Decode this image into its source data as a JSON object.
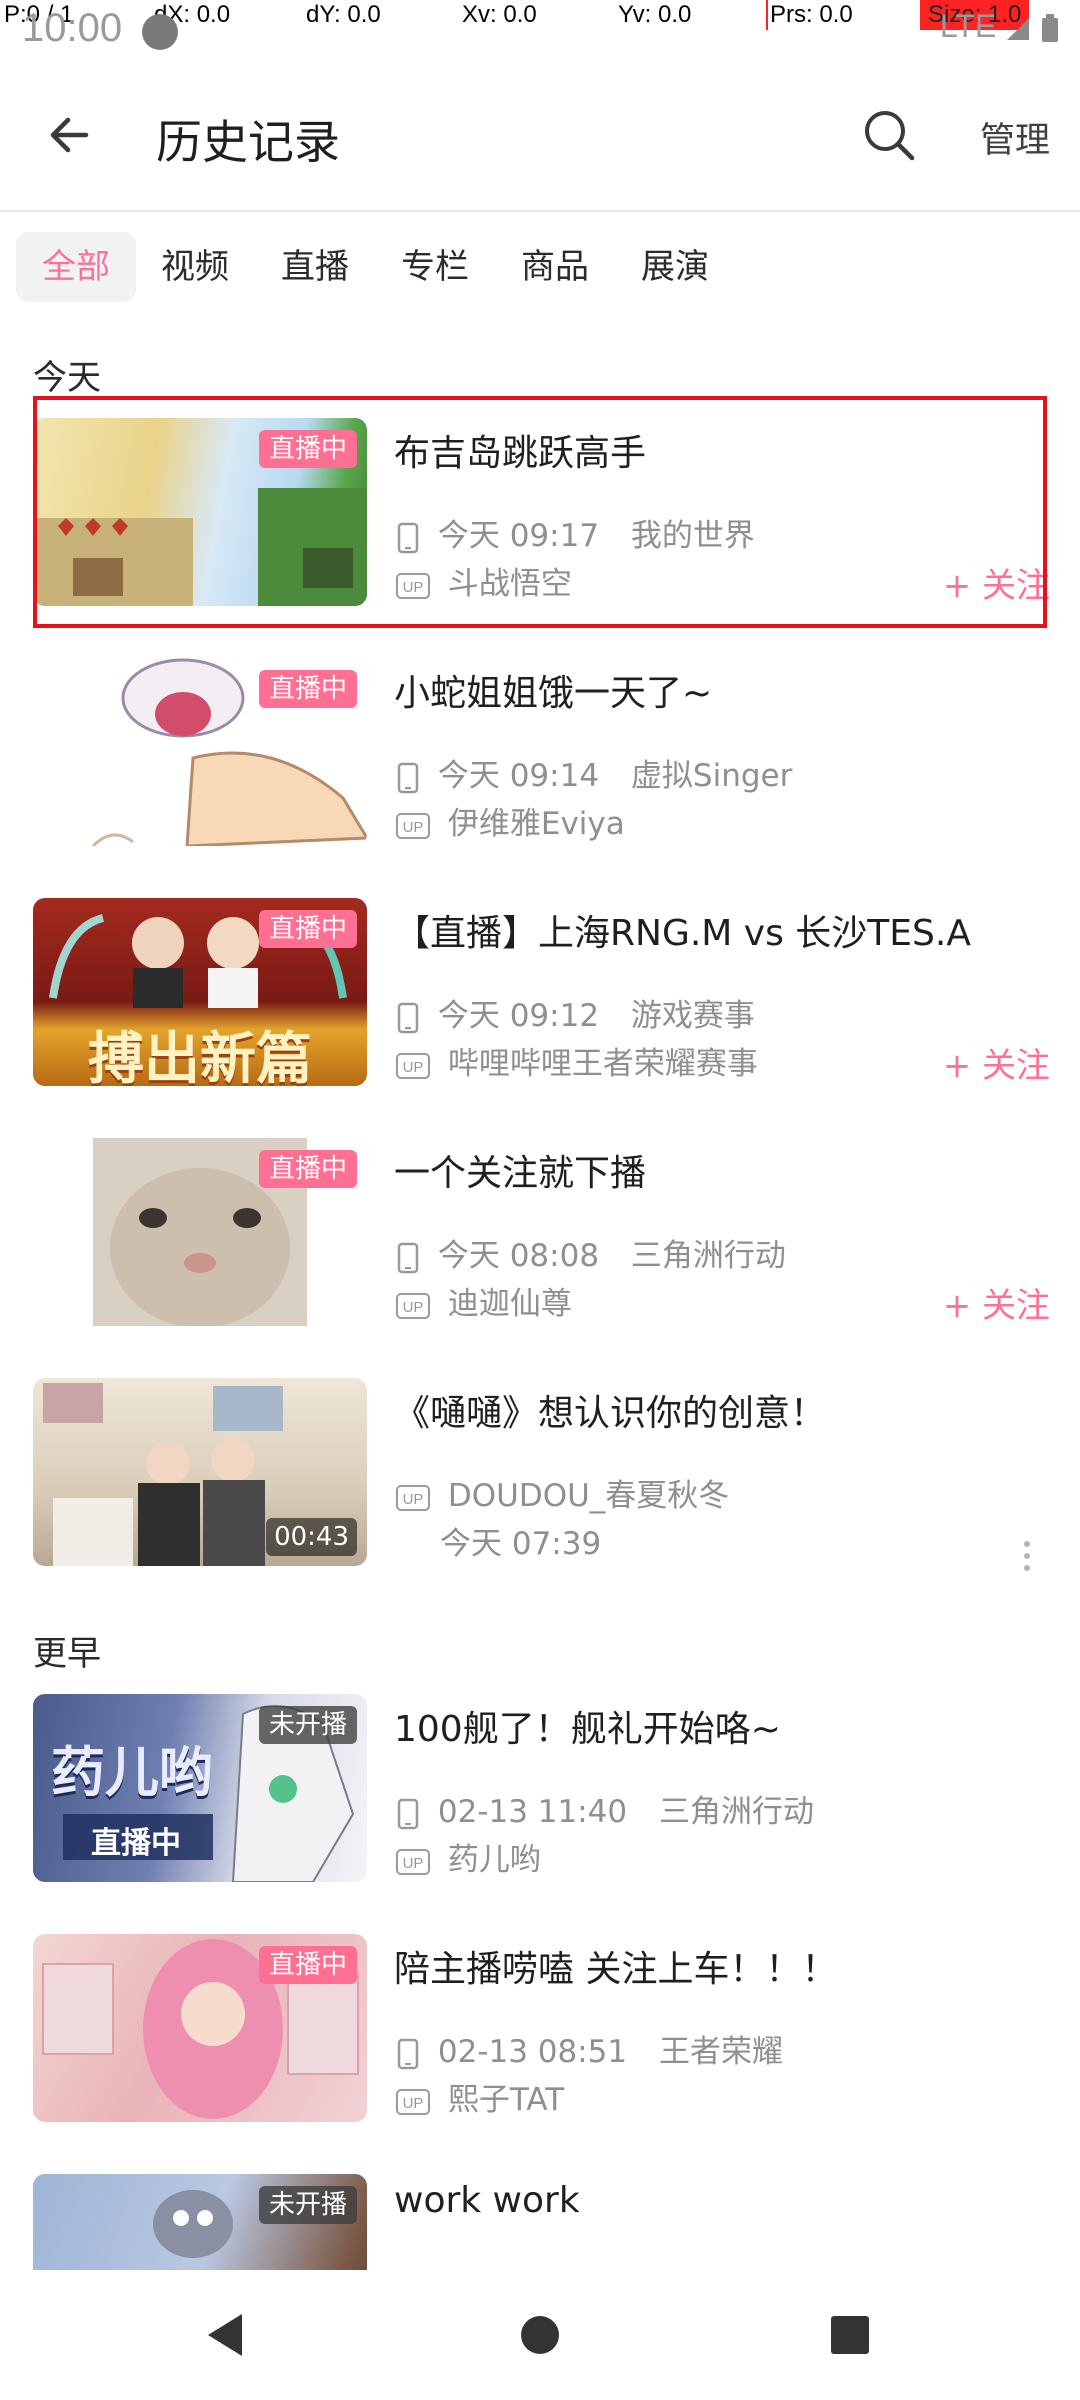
{
  "debug": {
    "pointer": "P:0 / 1",
    "dx": "dX: 0.0",
    "dy": "dY: 0.0",
    "xv": "Xv: 0.0",
    "yv": "Yv: 0.0",
    "prs": "Prs: 0.0",
    "size": "Size: 1.0"
  },
  "status": {
    "time": "10:00",
    "right": "LTE"
  },
  "header": {
    "title": "历史记录",
    "manage": "管理"
  },
  "tabs": [
    {
      "label": "全部",
      "active": true
    },
    {
      "label": "视频"
    },
    {
      "label": "直播"
    },
    {
      "label": "专栏"
    },
    {
      "label": "商品"
    },
    {
      "label": "展演"
    }
  ],
  "sections": {
    "today": "今天",
    "earlier": "更早"
  },
  "colors": {
    "accent": "#fb7299",
    "live_badge": "#ff6f94",
    "selection": "#e8101a"
  },
  "cards": [
    {
      "title": "布吉岛跳跃高手",
      "badge": "直播中",
      "time": "今天 09:17",
      "category": "我的世界",
      "up": "斗战悟空",
      "follow": "+ 关注",
      "selected": true
    },
    {
      "title": "小蛇姐姐饿一天了~",
      "badge": "直播中",
      "time": "今天 09:14",
      "category": "虚拟Singer",
      "up": "伊维雅Eviya"
    },
    {
      "title": "【直播】上海RNG.M vs 长沙TES.A",
      "badge": "直播中",
      "thumb_text": "搏出新篇",
      "time": "今天 09:12",
      "category": "游戏赛事",
      "up": "哔哩哔哩王者荣耀赛事",
      "follow": "+ 关注"
    },
    {
      "title": "一个关注就下播",
      "badge": "直播中",
      "time": "今天 08:08",
      "category": "三角洲行动",
      "up": "迪迦仙尊",
      "follow": "+ 关注"
    },
    {
      "title": "《嗵嗵》想认识你的创意！",
      "duration": "00:43",
      "up": "DOUDOU_春夏秋冬",
      "time": "今天 07:39"
    },
    {
      "title": "100舰了！舰礼开始咯~",
      "badge": "未开播",
      "thumb_text": "药儿哟",
      "thumb_sub": "直播中",
      "time": "02-13 11:40",
      "category": "三角洲行动",
      "up": "药儿哟"
    },
    {
      "title": "陪主播唠嗑 关注上车！！！",
      "badge": "直播中",
      "time": "02-13 08:51",
      "category": "王者荣耀",
      "up": "熙子TAT"
    },
    {
      "title": "work work",
      "badge": "未开播"
    }
  ],
  "icons": [
    "back-arrow-icon",
    "search-icon",
    "device-phone-icon",
    "up-tag-icon",
    "more-vertical-icon",
    "nav-back-icon",
    "nav-home-icon",
    "nav-recents-icon"
  ]
}
